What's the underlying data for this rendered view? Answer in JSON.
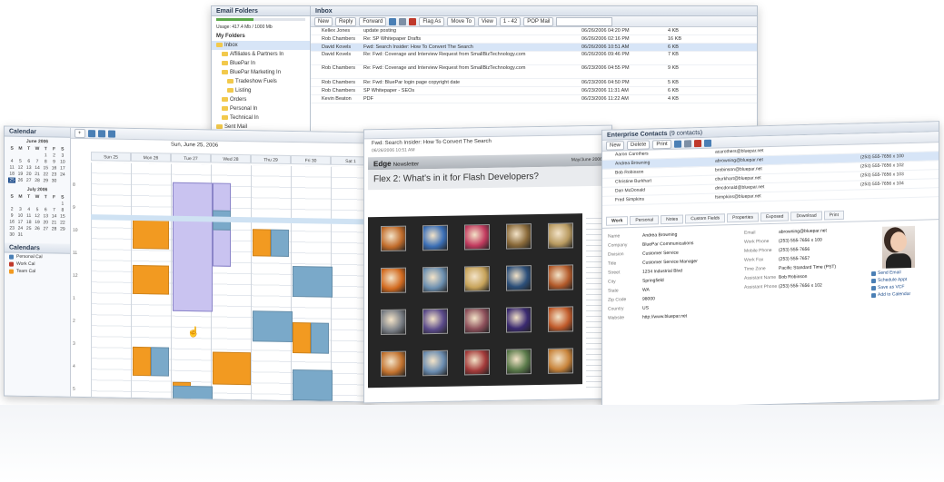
{
  "email": {
    "folders_title": "Email Folders",
    "usage": "Usage: 417.4 Mb / 1000 Mb",
    "my_folders": "My Folders",
    "tree": [
      "Inbox",
      "Affiliates & Partners In",
      "BluePar In",
      "BluePar Marketing In",
      "Tradeshow Fuels",
      "Listing",
      "Orders",
      "Personal In",
      "Technical In",
      "Sent Mail"
    ],
    "inbox_title": "Inbox",
    "toolbar": [
      "New",
      "Reply",
      "Forward",
      "Flag As",
      "Move To",
      "View",
      "1 - 42",
      "POP Mail"
    ],
    "messages": [
      {
        "from": "Kellex Jones",
        "subject": "update posting",
        "date": "06/26/2006 04:20 PM",
        "size": "4 KB"
      },
      {
        "from": "Rob Chambers",
        "subject": "Re: SP Whitepaper Drafts",
        "date": "06/26/2006 02:16 PM",
        "size": "16 KB"
      },
      {
        "from": "David Kovels",
        "subject": "Fwd: Search Insider: How To Convert The Search",
        "date": "06/26/2006 10:51 AM",
        "size": "6 KB"
      },
      {
        "from": "David Kovels",
        "subject": "Re: Fwd: Coverage and Interview Request from SmallBizTechnology.com",
        "date": "06/26/2006 09:46 PM",
        "size": "7 KB"
      },
      {
        "from": "Rob Chambers",
        "subject": "Re: Fwd: Coverage and Interview Request from SmallBizTechnology.com",
        "date": "06/23/2006 04:55 PM",
        "size": "9 KB"
      },
      {
        "from": "Rob Chambers",
        "subject": "Re: Fwd: BluePar login page copyright date",
        "date": "06/23/2006 04:50 PM",
        "size": "5 KB"
      },
      {
        "from": "Rob Chambers",
        "subject": "SP Whitepaper - SEOs",
        "date": "06/23/2006 11:31 AM",
        "size": "6 KB"
      },
      {
        "from": "Kevin Beaton",
        "subject": "PDF",
        "date": "06/23/2006 11:22 AM",
        "size": "4 KB"
      }
    ]
  },
  "calendar": {
    "title": "Calendar",
    "range_label": "Sun, June 25, 2006",
    "mini_month": "June 2006",
    "mini_month2": "July 2006",
    "days": [
      "Sun 25",
      "Mon 26",
      "Tue 27",
      "Wed 28",
      "Thu 29",
      "Fri 30",
      "Sat 1"
    ],
    "times": [
      "8",
      "9",
      "10",
      "11",
      "12",
      "1",
      "2",
      "3",
      "4",
      "5"
    ],
    "calendars_label": "Calendars",
    "cal_items": [
      "Personal Cal",
      "Work Cal",
      "Team Cal"
    ]
  },
  "newsletter": {
    "from_line": "Fwd: Search Insider: How To Convert The Search",
    "date_line": "06/26/2006 10:51 AM",
    "brand": "Edge",
    "brand_sub": "Newsletter",
    "issue": "May/June 2006",
    "headline": "Flex 2: What's in it for Flash Developers?"
  },
  "contacts": {
    "title": "Enterprise Contacts",
    "count_label": "(9 contacts)",
    "toolbar": [
      "New",
      "Delete",
      "Print"
    ],
    "people": [
      {
        "name": "Aaron Carothers",
        "email": "acarothers@bluepar.net",
        "phone": ""
      },
      {
        "name": "Andrea Browning",
        "email": "abrowning@bluepar.net",
        "phone": "(253) 555-7656 x 100"
      },
      {
        "name": "Bob Robinson",
        "email": "brobinson@bluepar.net",
        "phone": "(253) 555-7656 x 102"
      },
      {
        "name": "Christine Burkhart",
        "email": "cburkhart@bluepar.net",
        "phone": "(253) 555-7656 x 103"
      },
      {
        "name": "Dan McDonald",
        "email": "dmcdonald@bluepar.net",
        "phone": "(253) 555-7656 x 104"
      },
      {
        "name": "Fred Simpkins",
        "email": "fsimpkins@bluepar.net",
        "phone": ""
      }
    ],
    "tabs": [
      "Work",
      "Personal",
      "Notes",
      "Custom Fields",
      "Properties",
      "Exposed",
      "Download",
      "Print"
    ],
    "fields": [
      {
        "k": "Name",
        "v": "Andrea Browning"
      },
      {
        "k": "Company",
        "v": "BluePar Communications"
      },
      {
        "k": "Division",
        "v": "Customer Service"
      },
      {
        "k": "Title",
        "v": "Customer Service Manager"
      },
      {
        "k": "Street",
        "v": "1234 Industrial Blvd"
      },
      {
        "k": "City",
        "v": "Springfield"
      },
      {
        "k": "State",
        "v": "WA"
      },
      {
        "k": "Zip Code",
        "v": "98000"
      },
      {
        "k": "Country",
        "v": "US"
      },
      {
        "k": "Website",
        "v": "http://www.bluepar.net"
      }
    ],
    "right_fields": [
      {
        "k": "Email",
        "v": "abrowning@bluepar.net"
      },
      {
        "k": "Work Phone",
        "v": "(253) 555-7656 x 100"
      },
      {
        "k": "Mobile Phone",
        "v": "(253) 555-7656"
      },
      {
        "k": "Work Fax",
        "v": "(253) 555-7657"
      },
      {
        "k": "Time Zone",
        "v": "Pacific Standard Time (PST)"
      },
      {
        "k": "Assistant Name",
        "v": "Bob Robinson"
      },
      {
        "k": "Assistant Phone",
        "v": "(253) 555-7656 x 102"
      }
    ],
    "actions": [
      "Send Email",
      "Schedule Appt",
      "Save as VCF",
      "Add to Calendar"
    ]
  },
  "colors": {
    "accent": "#1f4e8c",
    "orange": "#f29a21",
    "blue": "#7aa9c9",
    "purple": "#c9c3f0"
  }
}
